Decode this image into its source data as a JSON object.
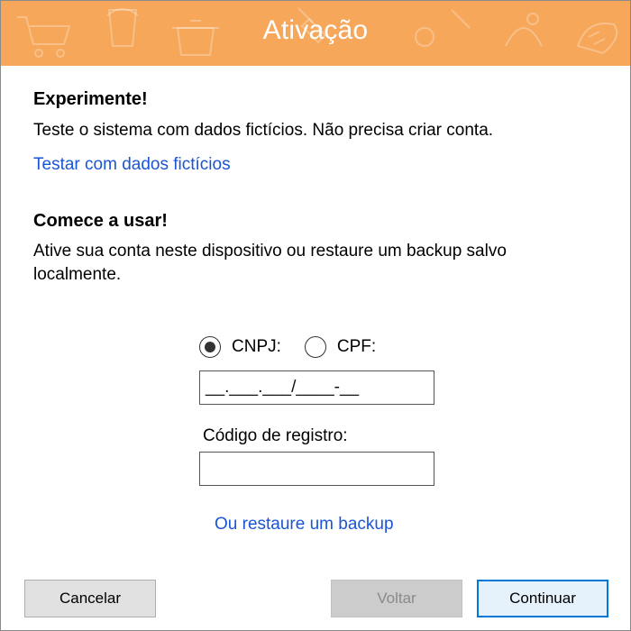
{
  "window": {
    "title": "Ativação",
    "accent_color": "#f6a75a"
  },
  "trial": {
    "heading": "Experimente!",
    "description": "Teste o sistema com dados fictícios. Não precisa criar conta.",
    "link_label": "Testar com dados fictícios"
  },
  "start": {
    "heading": "Comece a usar!",
    "description_line1": "Ative sua conta neste dispositivo ou restaure um backup salvo",
    "description_line2": "localmente."
  },
  "document_type": {
    "options": [
      {
        "label": "CNPJ:",
        "selected": true
      },
      {
        "label": "CPF:",
        "selected": false
      }
    ],
    "mask_value": "__.___.___/____-__"
  },
  "registration": {
    "label": "Código de registro:",
    "value": ""
  },
  "restore_link": "Ou restaure um backup",
  "buttons": {
    "cancel": "Cancelar",
    "back": "Voltar",
    "continue": "Continuar"
  },
  "icons": [
    "shopping-cart-icon",
    "paint-bucket-icon",
    "cooking-pot-icon",
    "spatula-icon",
    "bread-icon"
  ]
}
